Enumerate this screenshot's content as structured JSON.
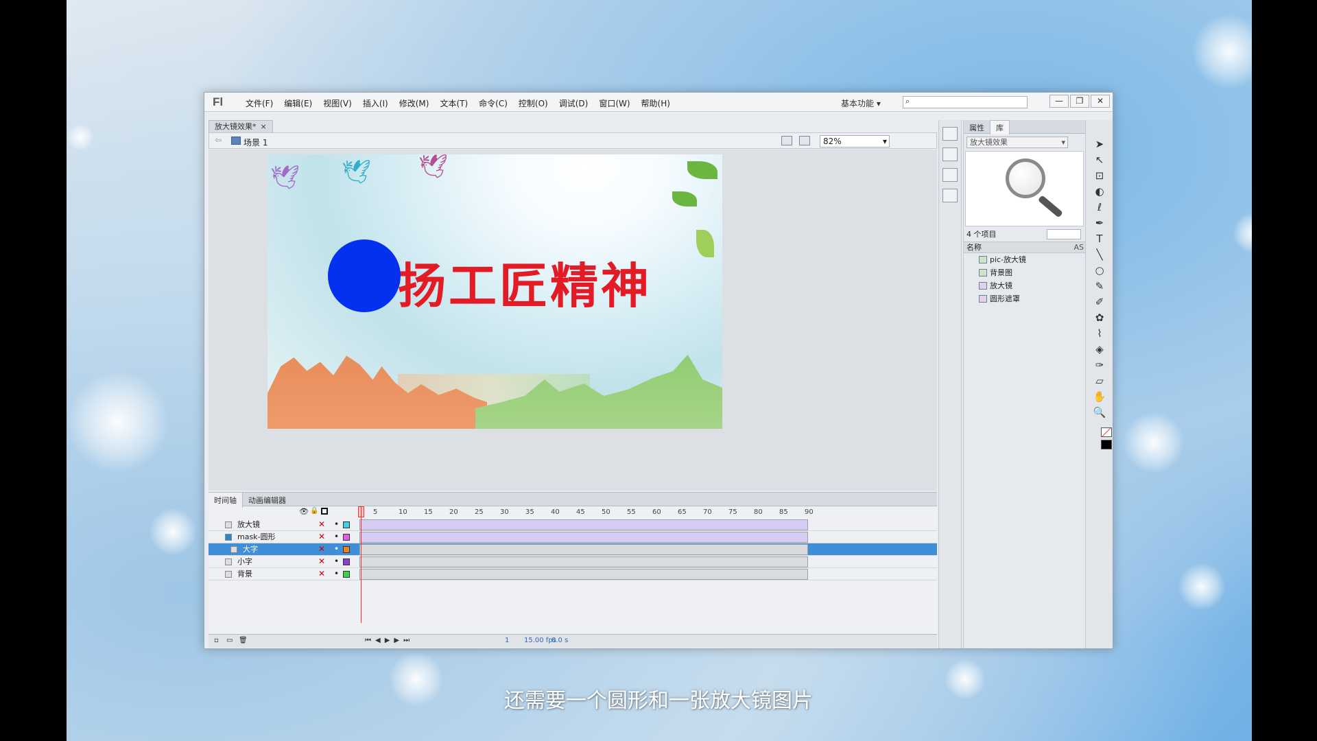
{
  "app": {
    "logo": "Fl",
    "menu": [
      "文件(F)",
      "编辑(E)",
      "视图(V)",
      "插入(I)",
      "修改(M)",
      "文本(T)",
      "命令(C)",
      "控制(O)",
      "调试(D)",
      "窗口(W)",
      "帮助(H)"
    ],
    "workspace": "基本功能",
    "window_buttons": [
      "—",
      "❐",
      "✕"
    ]
  },
  "document": {
    "tab_label": "放大镜效果*",
    "tab_close": "×",
    "scene_label": "场景 1",
    "zoom": "82%"
  },
  "stage": {
    "headline": "扬工匠精神",
    "circle_color": "#0430f0",
    "headline_color": "#e21b25"
  },
  "library": {
    "tabs": [
      "属性",
      "库"
    ],
    "selected_doc": "放大镜效果",
    "count_label": "4 个项目",
    "column_name": "名称",
    "column_as": "AS",
    "items": [
      {
        "name": "pic-放大镜",
        "type": "bitmap"
      },
      {
        "name": "背景图",
        "type": "bitmap"
      },
      {
        "name": "放大镜",
        "type": "movieclip"
      },
      {
        "name": "圆形遮罩",
        "type": "movieclip"
      }
    ]
  },
  "tools": [
    "➤",
    "↖",
    "⊡",
    "◐",
    "ℓ",
    "✒",
    "T",
    "╲",
    "○",
    "✎",
    "✐",
    "✿",
    "⌇",
    "◈",
    "✑",
    "▱",
    "✋",
    "🔍"
  ],
  "timeline": {
    "tabs": [
      "时间轴",
      "动画编辑器"
    ],
    "frame_numbers": [
      "5",
      "10",
      "15",
      "20",
      "25",
      "30",
      "35",
      "40",
      "45",
      "50",
      "55",
      "60",
      "65",
      "70",
      "75",
      "80",
      "85",
      "90"
    ],
    "layers": [
      {
        "name": "放大镜",
        "color": "#3fd0e0",
        "tween": true,
        "selected": false
      },
      {
        "name": "mask-圆形",
        "color": "#e35ee0",
        "tween": true,
        "selected": false
      },
      {
        "name": "大字",
        "color": "#f0821e",
        "tween": false,
        "selected": true
      },
      {
        "name": "小字",
        "color": "#8a3fd0",
        "tween": false,
        "selected": false
      },
      {
        "name": "背景",
        "color": "#3fd04a",
        "tween": false,
        "selected": false
      }
    ],
    "current_frame": "1",
    "fps": "15.00 fps",
    "time": "0.0 s"
  },
  "subtitle": "还需要一个圆形和一张放大镜图片"
}
